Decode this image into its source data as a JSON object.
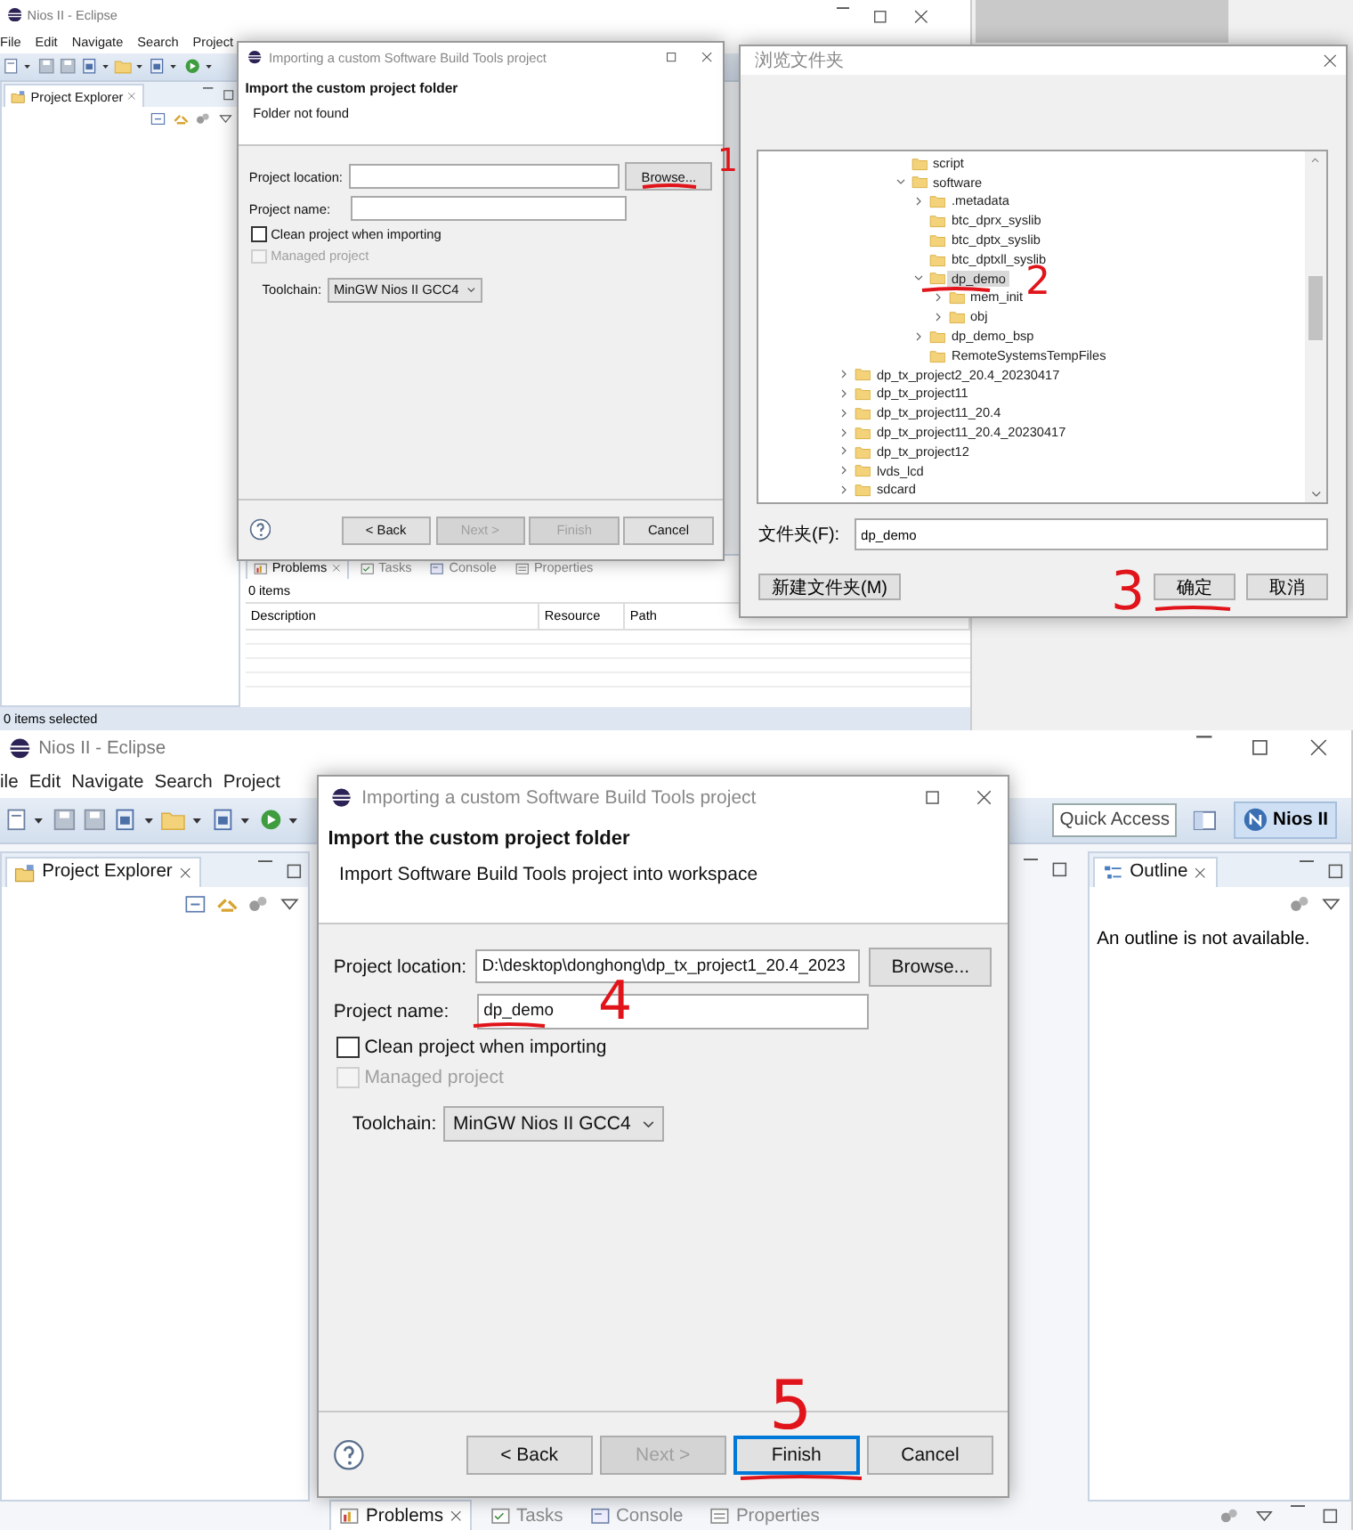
{
  "top": {
    "eclipse": {
      "title": "Nios II - Eclipse",
      "menu": [
        "File",
        "Edit",
        "Navigate",
        "Search",
        "Project"
      ],
      "explorer_tab": "Project Explorer",
      "bottom_tabs": [
        {
          "label": "Problems",
          "selected": true
        },
        {
          "label": "Tasks",
          "selected": false
        },
        {
          "label": "Console",
          "selected": false
        },
        {
          "label": "Properties",
          "selected": false
        }
      ],
      "problems_count": "0 items",
      "columns": [
        "Description",
        "Resource",
        "Path"
      ],
      "status": "0 items selected"
    },
    "import_dialog": {
      "title": "Importing a custom Software Build Tools project",
      "heading": "Import the custom project folder",
      "message": "Folder not found",
      "location_label": "Project location:",
      "name_label": "Project name:",
      "browse": "Browse...",
      "checkboxes": [
        {
          "label": "Clean project when importing",
          "checked": false,
          "disabled": false
        },
        {
          "label": "Managed project",
          "checked": false,
          "disabled": true
        }
      ],
      "toolchain_label": "Toolchain:",
      "toolchain": "MinGW Nios II GCC4",
      "buttons": [
        {
          "label": "< Back",
          "disabled": false,
          "default": false
        },
        {
          "label": "Next >",
          "disabled": true,
          "default": false
        },
        {
          "label": "Finish",
          "disabled": true,
          "default": false
        },
        {
          "label": "Cancel",
          "disabled": false,
          "default": false
        }
      ]
    },
    "browse_dialog": {
      "title": "浏览文件夹",
      "tree": [
        {
          "children": [
            {
              "label": "script",
              "kind": "leaf",
              "selected": false
            },
            {
              "label": "software",
              "kind": "branch",
              "expanded": true,
              "selected": false,
              "children": [
                {
                  "label": ".metadata",
                  "kind": "branch",
                  "expanded": false,
                  "selected": false
                },
                {
                  "label": "btc_dprx_syslib",
                  "kind": "leaf",
                  "selected": false
                },
                {
                  "label": "btc_dptx_syslib",
                  "kind": "leaf",
                  "selected": false
                },
                {
                  "label": "btc_dptxll_syslib",
                  "kind": "leaf",
                  "selected": false
                },
                {
                  "label": "dp_demo",
                  "kind": "branch",
                  "expanded": true,
                  "selected": true,
                  "children": [
                    {
                      "label": "mem_init",
                      "kind": "branch",
                      "expanded": false,
                      "selected": false
                    },
                    {
                      "label": "obj",
                      "kind": "branch",
                      "expanded": false,
                      "selected": false
                    }
                  ]
                },
                {
                  "label": "dp_demo_bsp",
                  "kind": "branch",
                  "expanded": false,
                  "selected": false
                },
                {
                  "label": "RemoteSystemsTempFiles",
                  "kind": "leaf",
                  "selected": false
                }
              ]
            }
          ]
        },
        {
          "label": "dp_tx_project2_20.4_20230417",
          "kind": "branch",
          "expanded": false,
          "selected": false
        },
        {
          "label": "dp_tx_project11",
          "kind": "branch",
          "expanded": false,
          "selected": false
        },
        {
          "label": "dp_tx_project11_20.4",
          "kind": "branch",
          "expanded": false,
          "selected": false
        },
        {
          "label": "dp_tx_project11_20.4_20230417",
          "kind": "branch",
          "expanded": false,
          "selected": false
        },
        {
          "label": "dp_tx_project12",
          "kind": "branch",
          "expanded": false,
          "selected": false
        },
        {
          "label": "lvds_lcd",
          "kind": "branch",
          "expanded": false,
          "selected": false
        },
        {
          "label": "sdcard",
          "kind": "branch",
          "expanded": false,
          "selected": false
        }
      ],
      "folder_label": "文件夹(F):",
      "folder_value": "dp_demo",
      "new_folder": "新建文件夹(M)",
      "ok": "确定",
      "cancel": "取消"
    },
    "annotations": [
      {
        "text": "1"
      },
      {
        "text": "2"
      },
      {
        "text": "3"
      }
    ]
  },
  "bottom": {
    "eclipse": {
      "title": "Nios II - Eclipse",
      "menu": [
        "ile",
        "Edit",
        "Navigate",
        "Search",
        "Project"
      ],
      "quick_access": {
        "placeholder": "Quick Access"
      },
      "perspective": "Nios II",
      "explorer_tab": "Project Explorer",
      "outline_tab": "Outline",
      "outline_message": "An outline is not available.",
      "bottom_tabs": [
        {
          "label": "Problems",
          "selected": true
        },
        {
          "label": "Tasks",
          "selected": false
        },
        {
          "label": "Console",
          "selected": false
        },
        {
          "label": "Properties",
          "selected": false
        }
      ]
    },
    "import_dialog": {
      "title": "Importing a custom Software Build Tools project",
      "heading": "Import the custom project folder",
      "message": "Import Software Build Tools project into workspace",
      "location_label": "Project location:",
      "location_value": "D:\\desktop\\donghong\\dp_tx_project1_20.4_2023",
      "name_label": "Project name:",
      "name_value": "dp_demo",
      "browse": "Browse...",
      "checkboxes": [
        {
          "label": "Clean project when importing",
          "checked": false,
          "disabled": false
        },
        {
          "label": "Managed project",
          "checked": false,
          "disabled": true
        }
      ],
      "toolchain_label": "Toolchain:",
      "toolchain": "MinGW Nios II GCC4",
      "buttons": [
        {
          "label": "< Back",
          "disabled": false,
          "default": false
        },
        {
          "label": "Next >",
          "disabled": true,
          "default": false
        },
        {
          "label": "Finish",
          "disabled": false,
          "default": true
        },
        {
          "label": "Cancel",
          "disabled": false,
          "default": false
        }
      ]
    },
    "annotations": [
      {
        "text": "4"
      },
      {
        "text": "5"
      }
    ]
  }
}
